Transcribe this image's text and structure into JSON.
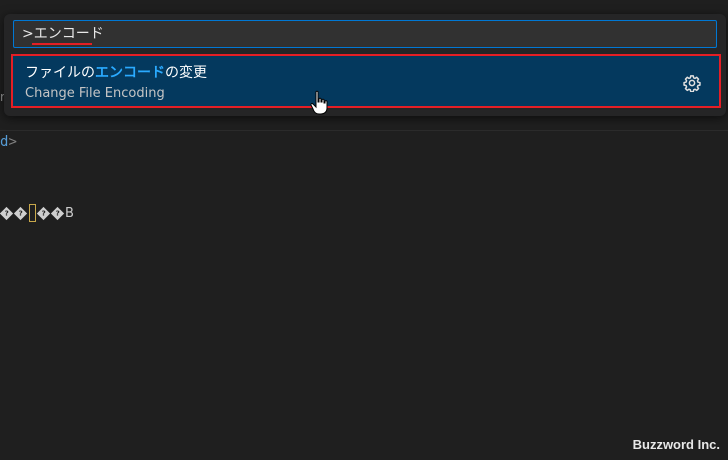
{
  "command_palette": {
    "input_value": ">エンコード",
    "result": {
      "title_before": "ファイルの",
      "title_highlight": "エンコード",
      "title_after": "の変更",
      "subtitle": "Change File Encoding",
      "action_icon": "gear-icon"
    }
  },
  "editor": {
    "line1_text": "d",
    "line1_suffix": ">",
    "line2_glyphs": [
      "?",
      "?",
      "?",
      "?"
    ],
    "line2_tail": "B"
  },
  "watermark": "Buzzword Inc.",
  "colors": {
    "accent": "#0078d4",
    "selection": "#04395e",
    "highlight": "#2aaaff",
    "annotation_red": "#e51e25"
  }
}
